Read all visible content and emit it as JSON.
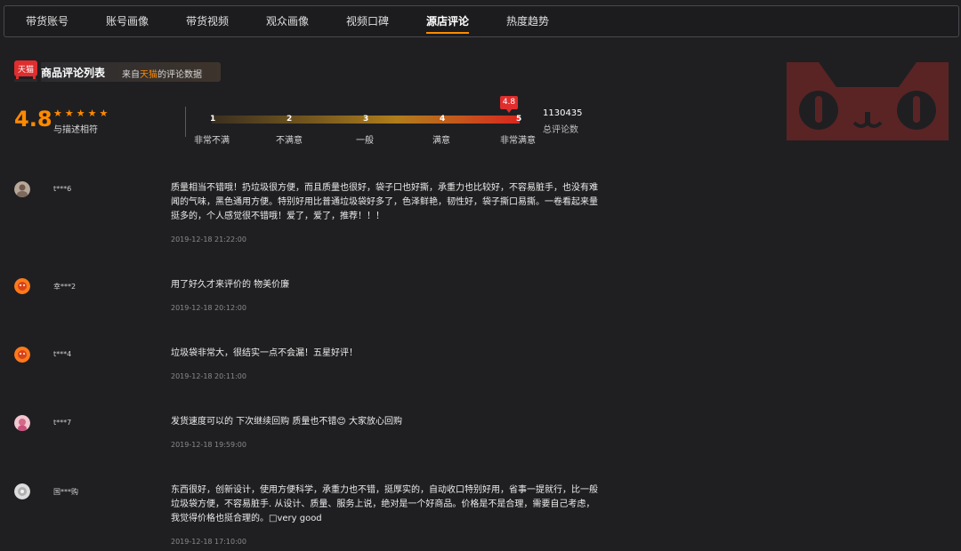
{
  "tabs": [
    {
      "label": "带货账号"
    },
    {
      "label": "账号画像"
    },
    {
      "label": "带货视频"
    },
    {
      "label": "观众画像"
    },
    {
      "label": "视频口碑"
    },
    {
      "label": "源店评论"
    },
    {
      "label": "热度趋势"
    }
  ],
  "active_tab": "源店评论",
  "section": {
    "logo_text": "天猫",
    "title": "商品评论列表",
    "source_prefix": "来自",
    "source_highlight": "天猫",
    "source_suffix": "的评论数据"
  },
  "rating": {
    "score": "4.8",
    "stars": "★★★★★",
    "desc": "与描述相符",
    "scale_numbers": [
      "1",
      "2",
      "3",
      "4",
      "5"
    ],
    "scale_labels": [
      "非常不满",
      "不满意",
      "一般",
      "满意",
      "非常满意"
    ],
    "marker_value": "4.8",
    "total_count": "1130435",
    "total_label": "总评论数"
  },
  "colors": {
    "accent": "#ff8a00",
    "marker": "#e02d2d",
    "background": "#1f1f22",
    "watermark": "#5a2424"
  },
  "reviews": [
    {
      "user": "t***6",
      "avatar_icon": "user-avatar-icon",
      "text": "质量相当不错哦！扔垃圾很方便，而且质量也很好，袋子口也好撕，承重力也比较好，不容易脏手，也没有难闻的气味，黑色通用方便。特别好用比普通垃圾袋好多了，色泽鲜艳，韧性好，袋子撕口易撕。一卷看起来量挺多的，个人感觉很不错哦！爱了，爱了，推荐！！！",
      "date": "2019-12-18 21:22:00"
    },
    {
      "user": "幸***2",
      "avatar_icon": "default-avatar-icon",
      "text": "用了好久才来评价的 物美价廉",
      "date": "2019-12-18 20:12:00"
    },
    {
      "user": "t***4",
      "avatar_icon": "default-avatar-icon",
      "text": "垃圾袋非常大，很结实一点不会漏！五星好评！",
      "date": "2019-12-18 20:11:00"
    },
    {
      "user": "t***7",
      "avatar_icon": "user-avatar-icon",
      "text": "发货速度可以的 下次继续回购 质量也不错😊 大家放心回购",
      "date": "2019-12-18 19:59:00"
    },
    {
      "user": "国***购",
      "avatar_icon": "user-avatar-icon",
      "text": "东西很好，创新设计，使用方便科学，承重力也不错，挺厚实的，自动收口特别好用，省事一提就行，比一般垃圾袋方便，不容易脏手. 从设计、质量、服务上说，绝对是一个好商品。价格是不是合理，需要自己考虑，我觉得价格也挺合理的。□very good",
      "date": "2019-12-18 17:10:00"
    }
  ]
}
